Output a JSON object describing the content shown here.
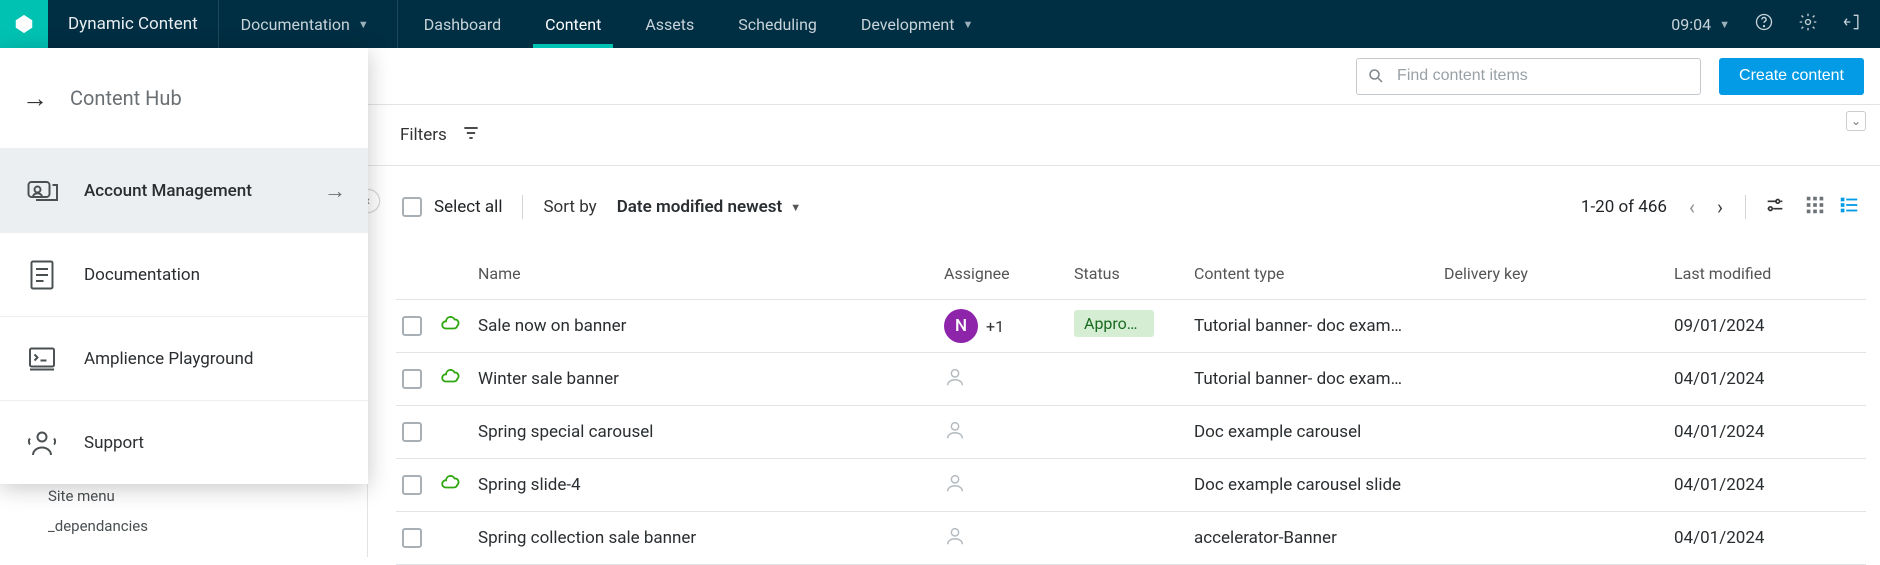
{
  "header": {
    "product_name": "Dynamic Content",
    "nav": {
      "documentation": "Documentation",
      "dashboard": "Dashboard",
      "content": "Content",
      "assets": "Assets",
      "scheduling": "Scheduling",
      "development": "Development"
    },
    "time": "09:04"
  },
  "subheader": {
    "title": "Content Hub",
    "search_placeholder": "Find content items",
    "create_button": "Create content"
  },
  "dropdown": {
    "title": "Content Hub",
    "items": [
      {
        "label": "Account Management",
        "has_arrow": true
      },
      {
        "label": "Documentation",
        "has_arrow": false
      },
      {
        "label": "Amplience Playground",
        "has_arrow": false
      },
      {
        "label": "Support",
        "has_arrow": false
      }
    ]
  },
  "tree": {
    "site_menu": "Site menu",
    "dependancies": "_dependancies"
  },
  "filters": {
    "label": "Filters"
  },
  "toolbar": {
    "select_all": "Select all",
    "sort_by": "Sort by",
    "sort_value": "Date modified newest",
    "page_range": "1-20 of 466"
  },
  "table": {
    "headers": {
      "name": "Name",
      "assignee": "Assignee",
      "status": "Status",
      "content_type": "Content type",
      "delivery_key": "Delivery key",
      "last_modified": "Last modified"
    },
    "rows": [
      {
        "cloud": true,
        "name": "Sale now on banner",
        "assignee_avatar": "N",
        "assignee_extra": "+1",
        "status_badge": "Approv…",
        "content_type": "Tutorial banner- doc exam…",
        "delivery_key": "",
        "last_modified": "09/01/2024"
      },
      {
        "cloud": true,
        "name": "Winter sale banner",
        "assignee_avatar": null,
        "assignee_extra": "",
        "status_badge": "",
        "content_type": "Tutorial banner- doc exam…",
        "delivery_key": "",
        "last_modified": "04/01/2024"
      },
      {
        "cloud": false,
        "name": "Spring special carousel",
        "assignee_avatar": null,
        "assignee_extra": "",
        "status_badge": "",
        "content_type": "Doc example carousel",
        "delivery_key": "",
        "last_modified": "04/01/2024"
      },
      {
        "cloud": true,
        "name": "Spring slide-4",
        "assignee_avatar": null,
        "assignee_extra": "",
        "status_badge": "",
        "content_type": "Doc example carousel slide",
        "delivery_key": "",
        "last_modified": "04/01/2024"
      },
      {
        "cloud": false,
        "name": "Spring collection sale banner",
        "assignee_avatar": null,
        "assignee_extra": "",
        "status_badge": "",
        "content_type": "accelerator-Banner",
        "delivery_key": "",
        "last_modified": "04/01/2024"
      }
    ]
  }
}
